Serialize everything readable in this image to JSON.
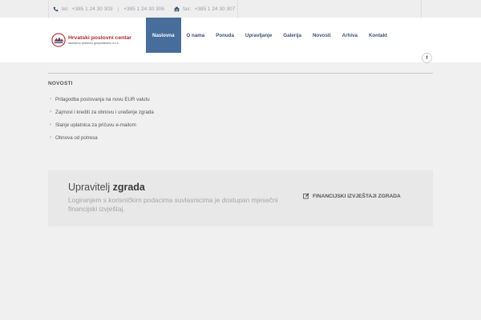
{
  "topbar": {
    "phone_icon": "phone-icon",
    "tel_label": "tel:",
    "tel1": "+385 1 24 30 303",
    "separator": "|",
    "tel2": "+385 1 24 30 306",
    "fax_icon": "fax-icon",
    "fax_label": "fax:",
    "fax": "+385 1 24 30 307"
  },
  "logo": {
    "name": "Hrvatski poslovni centar",
    "sub": "stambeno poslovno gospodarstvo d.o.o."
  },
  "nav": {
    "items": [
      {
        "label": "Naslovna",
        "active": true
      },
      {
        "label": "O nama"
      },
      {
        "label": "Ponuda"
      },
      {
        "label": "Upravljanje"
      },
      {
        "label": "Galerija"
      },
      {
        "label": "Novosti"
      },
      {
        "label": "Arhiva"
      },
      {
        "label": "Kontakt"
      }
    ]
  },
  "social": {
    "facebook_glyph": "f",
    "icon": "facebook-icon"
  },
  "news": {
    "title": "NOVOSTI",
    "items": [
      "Prilagodba poslovanja na novu EUR valutu",
      "Zajmovi i krediti za obnovu i uređenje zgrada",
      "Slanje uplatnica za pričuvu e-mailom",
      "Obnova od potresa"
    ]
  },
  "panel": {
    "title_light": "Upravitelj",
    "title_bold": "zgrada",
    "text": "Logiranjem s korisničkim podacima suvlasnicima je dostupan mjesečni financijski izvještaj.",
    "link": "FINANCIJSKI IZVJEŠTAJI ZGRADA",
    "link_icon": "edit-icon"
  },
  "colors": {
    "nav_active_bg": "#476d9b",
    "nav_text": "#3a5275",
    "logo_red": "#b0282c",
    "topbar_bg": "#eeeeee",
    "panel_bg": "#e8e8e8"
  }
}
